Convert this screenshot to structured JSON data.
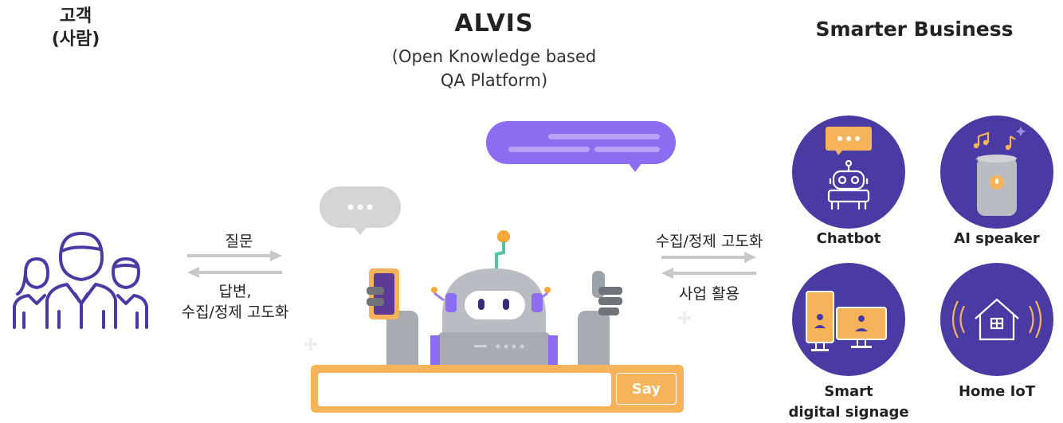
{
  "customer": {
    "line1": "고객",
    "line2": "(사람)"
  },
  "alvis": {
    "title": "ALVIS",
    "subtitle_line1": "(Open Knowledge based",
    "subtitle_line2": "QA Platform)"
  },
  "smarter": {
    "title": "Smarter Business"
  },
  "left_arrows": {
    "top_label": "질문",
    "bottom_label_line1": "답변,",
    "bottom_label_line2": "수집/정제 고도화"
  },
  "right_arrows": {
    "top_label": "수집/정제 고도화",
    "bottom_label": "사업 활용"
  },
  "input": {
    "button_label": "Say",
    "value": ""
  },
  "devices": [
    {
      "label_line1": "Chatbot",
      "label_line2": "",
      "icon": "robot-icon"
    },
    {
      "label_line1": "AI speaker",
      "label_line2": "",
      "icon": "speaker-icon"
    },
    {
      "label_line1": "Smart",
      "label_line2": "digital signage",
      "icon": "signage-icon"
    },
    {
      "label_line1": "Home IoT",
      "label_line2": "",
      "icon": "home-icon"
    }
  ],
  "colors": {
    "circle": "#4a3aa3",
    "accent_orange": "#f7b35a",
    "bubble_purple": "#8c6cf0",
    "arrow_gray": "#c8c8c8",
    "robot_gray": "#b9bcc2"
  }
}
